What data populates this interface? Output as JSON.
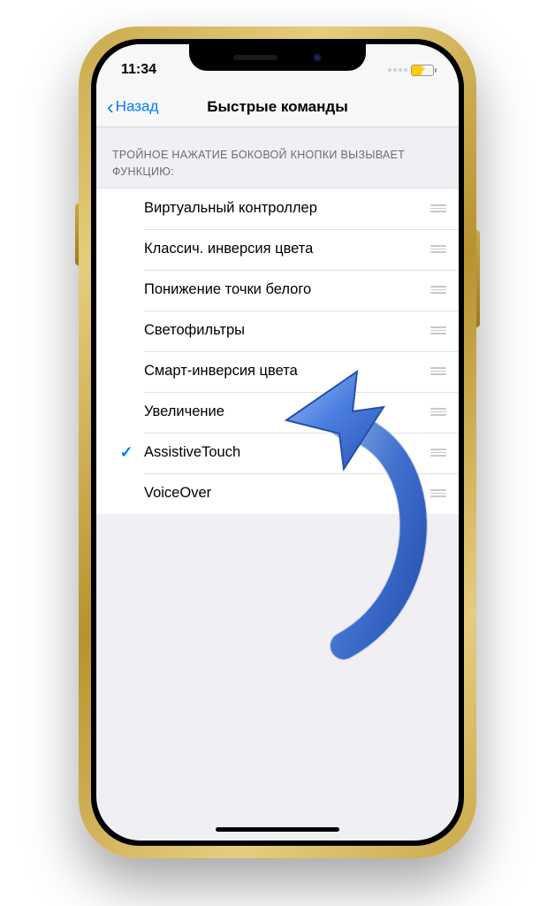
{
  "status": {
    "time": "11:34"
  },
  "nav": {
    "back": "Назад",
    "title": "Быстрые команды"
  },
  "section": {
    "header": "ТРОЙНОЕ НАЖАТИЕ БОКОВОЙ КНОПКИ ВЫЗЫВАЕТ ФУНКЦИЮ:"
  },
  "items": [
    {
      "label": "Виртуальный контроллер",
      "checked": false
    },
    {
      "label": "Классич. инверсия цвета",
      "checked": false
    },
    {
      "label": "Понижение точки белого",
      "checked": false
    },
    {
      "label": "Светофильтры",
      "checked": false
    },
    {
      "label": "Смарт-инверсия цвета",
      "checked": false
    },
    {
      "label": "Увеличение",
      "checked": false
    },
    {
      "label": "AssistiveTouch",
      "checked": true
    },
    {
      "label": "VoiceOver",
      "checked": false
    }
  ]
}
